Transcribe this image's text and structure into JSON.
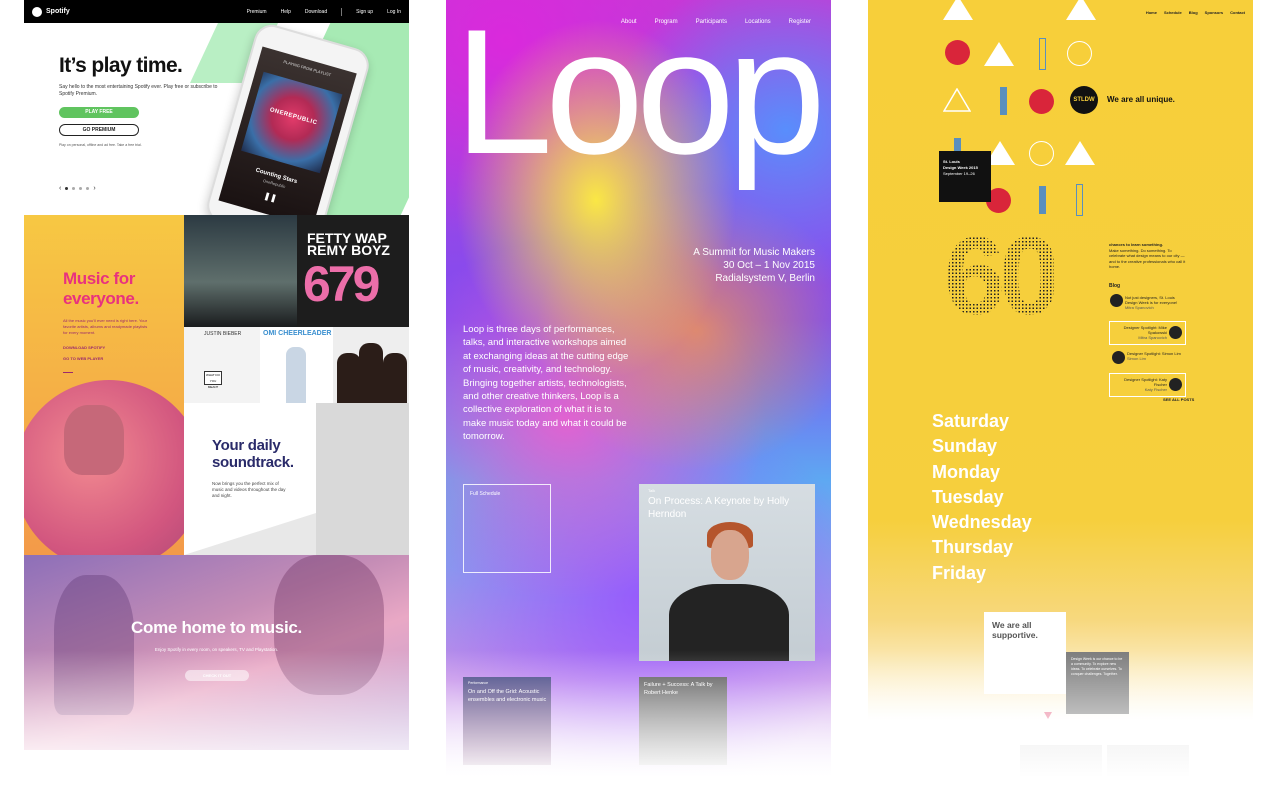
{
  "spotify": {
    "nav": {
      "brand": "Spotify",
      "links": [
        "Premium",
        "Help",
        "Download"
      ],
      "signup": "Sign up",
      "login": "Log In"
    },
    "hero": {
      "headline": "It’s play time.",
      "subtext": "Say hello to the most entertaining Spotify ever. Play free or subscribe to Spotify Premium.",
      "play_free": "PLAY FREE",
      "go_premium": "GO PREMIUM",
      "fine_print": "Play on personal, offline and ad free. Take a free trial."
    },
    "phone": {
      "header": "PLAYING FROM PLAYLIST",
      "album": "ONEREPUBLIC",
      "track": "Counting Stars",
      "artist": "OneRepublic"
    },
    "music_for_everyone": {
      "headline": "Music for everyone.",
      "body": "All the music you’ll ever need is right here. Your favorite artists, albums and readymade playlists for every moment.",
      "download": "DOWNLOAD SPOTIFY",
      "web_player": "GO TO WEB PLAYER"
    },
    "albums": {
      "fetty": "FETTY WAP",
      "remy": "REMY BOYZ",
      "remy_number": "679",
      "justin": "JUSTIN BIEBER",
      "sign": "WHAT DO YOU MEAN?",
      "omi": "OMI CHEERLEADER"
    },
    "daily": {
      "headline": "Your daily soundtrack.",
      "body": "Now brings you the perfect mix of music and videos throughout the day and night."
    },
    "come_home": {
      "headline": "Come home to music.",
      "body": "Enjoy Spotify in every room, on speakers, TV and Playstation.",
      "button": "CHECK IT OUT"
    }
  },
  "loop": {
    "nav": [
      "About",
      "Program",
      "Participants",
      "Locations",
      "Register"
    ],
    "logo": "Loop",
    "tagline": [
      "A Summit for Music Makers",
      "30 Oct – 1 Nov 2015",
      "Radialsystem V, Berlin"
    ],
    "body": "Loop is three days of performances, talks, and interactive workshops aimed at exchanging ideas at the cutting edge of music, creativity, and technology. Bringing together artists, technologists, and other creative thinkers, Loop is a collective exploration of what it is to make music today and what it could be tomorrow.",
    "full_schedule": "Full Schedule",
    "keynote": {
      "kicker": "Talk",
      "title": "On Process: A Keynote by Holly Herndon"
    },
    "performance": {
      "kicker": "Performance",
      "title": "On and Off the Grid: Acoustic ensembles and electronic music"
    },
    "talk": {
      "title": "Failure + Success: A Talk by Robert Henke"
    }
  },
  "design_week": {
    "nav": [
      "Home",
      "Schedule",
      "Blog",
      "Sponsors",
      "Contact"
    ],
    "badge": "STLDW",
    "unique": "We are all unique.",
    "event": [
      "St. Louis",
      "Design Week 2015",
      "September 19–26"
    ],
    "big_number": "60",
    "chances_title": "chances to learn something.",
    "chances_body": "Make something. Do something. To celebrate what design means to our city — and to the creative professionals who call it home.",
    "blog_title": "Blog",
    "posts": [
      {
        "title": "Not just designers, St. Louis Design Week is for everyone!",
        "author": "Mitra Spanovich"
      },
      {
        "title": "Designer Spotlight: Mike Spakowski",
        "author": "Mitra Spanovich"
      },
      {
        "title": "Designer Spotlight: Simon Lim",
        "author": "Simon Lim"
      },
      {
        "title": "Designer Spotlight: Katy Fischer",
        "author": "Katy Fischer"
      }
    ],
    "all_posts": "SEE ALL POSTS",
    "days": [
      "Saturday",
      "Sunday",
      "Monday",
      "Tuesday",
      "Wednesday",
      "Thursday",
      "Friday"
    ],
    "supportive": "We are all supportive.",
    "grey_card": "Design Week is our chance to be a community. To explore new ideas. To celebrate ourselves. To conquer challenges. Together."
  },
  "colors": {
    "spotify_green": "#60c45f",
    "spotify_pink": "#e8327e",
    "loop_white": "#ffffff",
    "stl_yellow": "#f7cf3a",
    "stl_red": "#d9253a",
    "stl_blue": "#5a8fbd"
  }
}
